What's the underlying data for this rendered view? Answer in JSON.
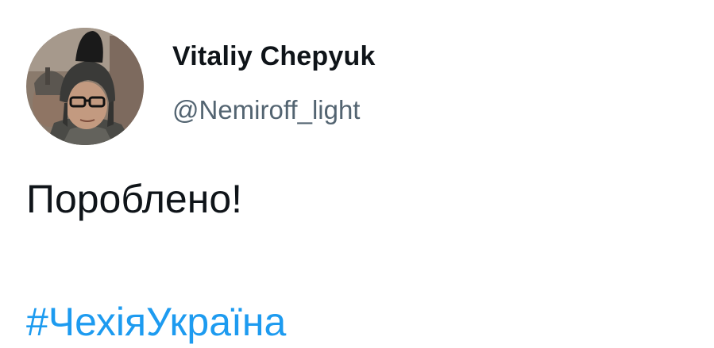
{
  "tweet": {
    "author": {
      "display_name": "Vitaliy Chepyuk",
      "handle": "@Nemiroff_light",
      "avatar_icon": "profile-photo-helmet"
    },
    "text": "Пороблено!",
    "hashtag": "#ЧехіяУкраїна"
  },
  "colors": {
    "name": "#0f1419",
    "handle": "#536471",
    "text": "#0f1419",
    "hashtag": "#1d9bf0"
  }
}
